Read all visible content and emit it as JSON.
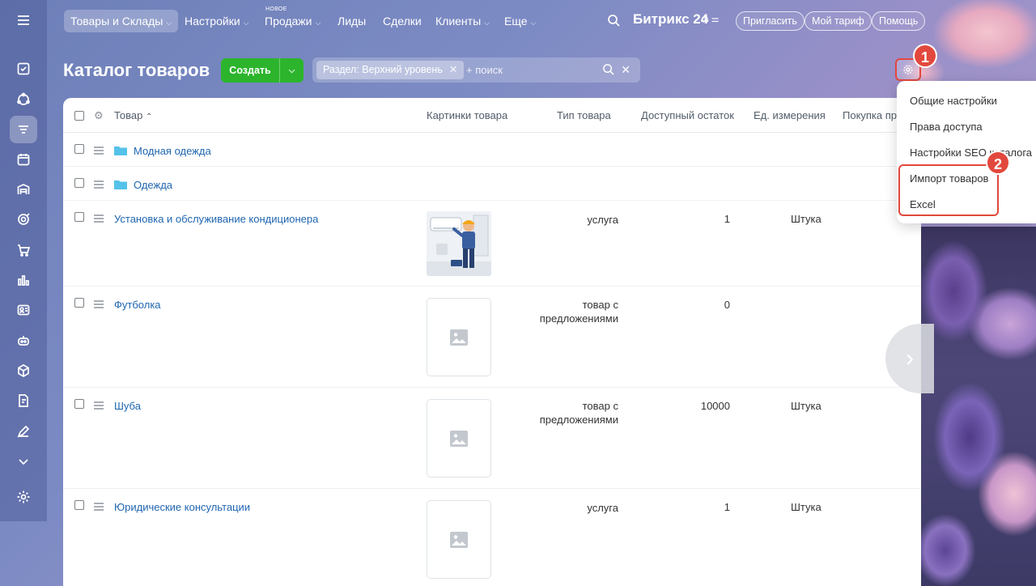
{
  "topbar": {
    "nav": [
      {
        "label": "Товары и Склады",
        "chevron": true
      },
      {
        "label": "Настройки",
        "chevron": true
      },
      {
        "label": "Продажи",
        "chevron": true,
        "badge": "НОВОЕ"
      },
      {
        "label": "Лиды",
        "chevron": false
      },
      {
        "label": "Сделки",
        "chevron": false
      },
      {
        "label": "Клиенты",
        "chevron": true
      },
      {
        "label": "Еще",
        "chevron": true
      }
    ],
    "brand": "Битрикс 24",
    "invite_label": "Пригласить",
    "tariff_label": "Мой тариф",
    "help_label": "Помощь"
  },
  "page": {
    "title": "Каталог товаров",
    "create_label": "Создать",
    "filter_tag": "Раздел: Верхний уровень",
    "search_placeholder": "+ поиск"
  },
  "steps": [
    "1",
    "2"
  ],
  "table": {
    "columns": [
      "Товар",
      "Картинки товара",
      "Тип товара",
      "Доступный остаток",
      "Ед. измерения",
      "Покупка пр"
    ],
    "rows": [
      {
        "name": "Модная одежда",
        "kind": "folder"
      },
      {
        "name": "Одежда",
        "kind": "folder"
      },
      {
        "name": "Установка и обслуживание кондиционера",
        "kind": "photo",
        "type": "услуга",
        "stock": "1",
        "unit": "Штука"
      },
      {
        "name": "Футболка",
        "kind": "placeholder",
        "type_line1": "товар с",
        "type_line2": "предложениями",
        "stock": "0",
        "unit": ""
      },
      {
        "name": "Шуба",
        "kind": "placeholder",
        "type_line1": "товар с",
        "type_line2": "предложениями",
        "stock": "10000",
        "unit": "Штука"
      },
      {
        "name": "Юридические консультации",
        "kind": "placeholder",
        "type": "услуга",
        "stock": "1",
        "unit": "Штука"
      }
    ]
  },
  "menu": {
    "items": [
      "Общие настройки",
      "Права доступа",
      "Настройки SEO каталога",
      "Импорт товаров",
      "Excel"
    ]
  },
  "colors": {
    "accent_green": "#2cb52c",
    "link_blue": "#2066b0",
    "highlight_red": "#e2483d"
  }
}
